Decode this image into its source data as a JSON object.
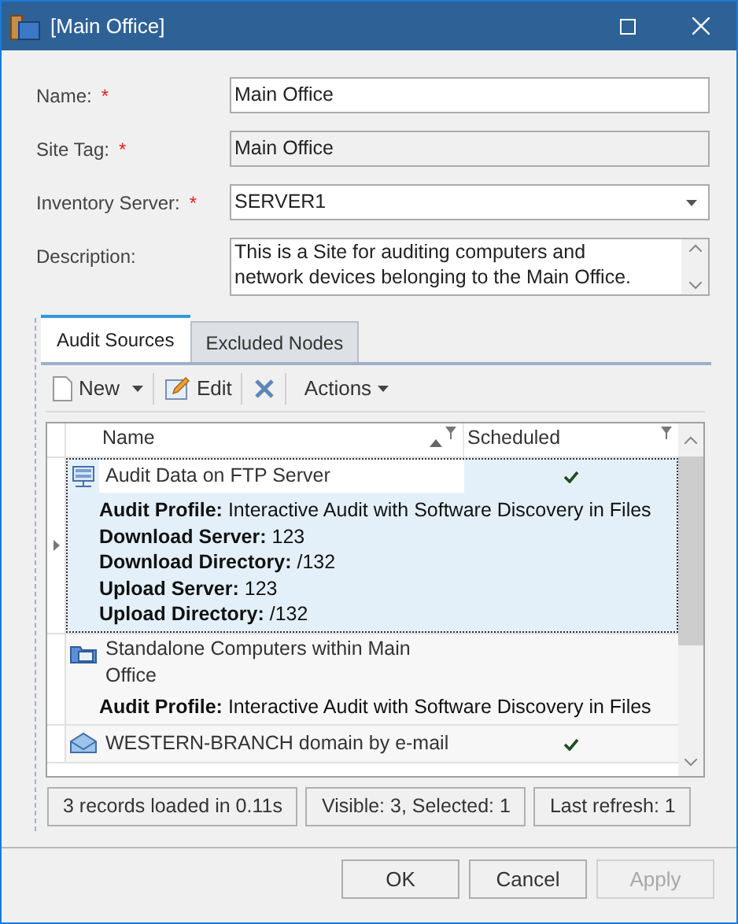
{
  "window": {
    "title": "[Main Office]"
  },
  "fields": [
    {
      "label": "Name:",
      "required_mark": "*",
      "kind": "text",
      "value": "Main Office"
    },
    {
      "label": "Site Tag:",
      "required_mark": "*",
      "kind": "readonly",
      "value": "Main Office"
    },
    {
      "label": "Inventory Server:",
      "required_mark": "*",
      "kind": "dropdown",
      "value": "SERVER1"
    },
    {
      "label": "Description:",
      "kind": "textarea",
      "value": "This is a Site for auditing computers and network devices belonging to the Main Office."
    }
  ],
  "tabs": [
    {
      "label": "Audit Sources",
      "selected": true
    },
    {
      "label": "Excluded Nodes",
      "selected": false
    }
  ],
  "toolbar": [
    {
      "kind": "new",
      "label": "New"
    },
    {
      "kind": "edit",
      "label": "Edit"
    },
    {
      "kind": "delete"
    },
    {
      "kind": "menu",
      "label": "Actions"
    }
  ],
  "table": {
    "columns": [
      {
        "label": "Name",
        "sorted": true
      },
      {
        "label": "Scheduled",
        "sorted": false
      }
    ],
    "rows": [
      {
        "kind": "server",
        "name": "Audit Data on FTP Server",
        "scheduled": true,
        "selected": true,
        "details": [
          {
            "label": "Audit Profile:",
            "value": "Interactive Audit with Software Discovery in Files"
          },
          {
            "label": "Download Server:",
            "value": "123"
          },
          {
            "label": "Download Directory:",
            "value": "/132"
          },
          {
            "label": "Upload Server:",
            "value": "123"
          },
          {
            "label": "Upload Directory:",
            "value": "/132"
          }
        ]
      },
      {
        "kind": "folder",
        "name": "Standalone Computers within Main Office",
        "scheduled": false,
        "selected": false,
        "details": [
          {
            "label": "Audit Profile:",
            "value": "Interactive Audit with Software Discovery in Files"
          }
        ]
      },
      {
        "kind": "mail",
        "name": "WESTERN-BRANCH domain by e-mail",
        "scheduled": true,
        "selected": false,
        "details": []
      }
    ]
  },
  "status_bar": [
    "3 records loaded in 0.11s",
    "Visible: 3, Selected: 1",
    "Last refresh: 1"
  ],
  "buttons": [
    {
      "label": "OK",
      "disabled": false
    },
    {
      "label": "Cancel",
      "disabled": false
    },
    {
      "label": "Apply",
      "disabled": true
    }
  ]
}
